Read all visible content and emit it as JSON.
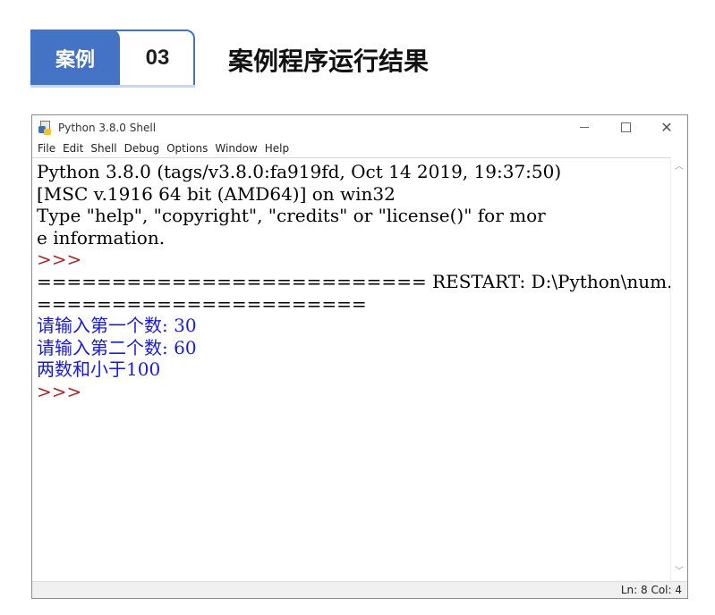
{
  "slide_header": {
    "tag": "案例",
    "number": "03",
    "title": "案例程序运行结果"
  },
  "window": {
    "title": "Python 3.8.0 Shell",
    "controls": {
      "minimize": "—",
      "maximize": "□",
      "close": "✕"
    }
  },
  "menu": [
    "File",
    "Edit",
    "Shell",
    "Debug",
    "Options",
    "Window",
    "Help"
  ],
  "shell_lines": [
    {
      "text": "Python 3.8.0 (tags/v3.8.0:fa919fd, Oct 14 2019, 19:37:50)",
      "kind": "normal"
    },
    {
      "text": "[MSC v.1916 64 bit (AMD64)] on win32",
      "kind": "normal"
    },
    {
      "text": "Type \"help\", \"copyright\", \"credits\" or \"license()\" for mor",
      "kind": "normal"
    },
    {
      "text": "e information.",
      "kind": "normal"
    },
    {
      "text": ">>>",
      "kind": "prompt"
    },
    {
      "text": "========================== RESTART: D:\\Python\\num.py ====",
      "kind": "normal"
    },
    {
      "text": "======================",
      "kind": "normal"
    },
    {
      "text": "请输入第一个数: 30",
      "kind": "stdout"
    },
    {
      "text": "请输入第二个数: 60",
      "kind": "stdout"
    },
    {
      "text": "两数和小于100",
      "kind": "stdout"
    },
    {
      "text": ">>>",
      "kind": "prompt"
    }
  ],
  "status": {
    "text": "Ln: 8  Col: 4"
  },
  "colors": {
    "accent": "#4472c4",
    "prompt": "#a52a2a",
    "stdout": "#1a1adb"
  },
  "icons": {
    "app": "python-idle-icon",
    "scroll_up": "chevron-up-icon",
    "scroll_down": "chevron-down-icon"
  }
}
